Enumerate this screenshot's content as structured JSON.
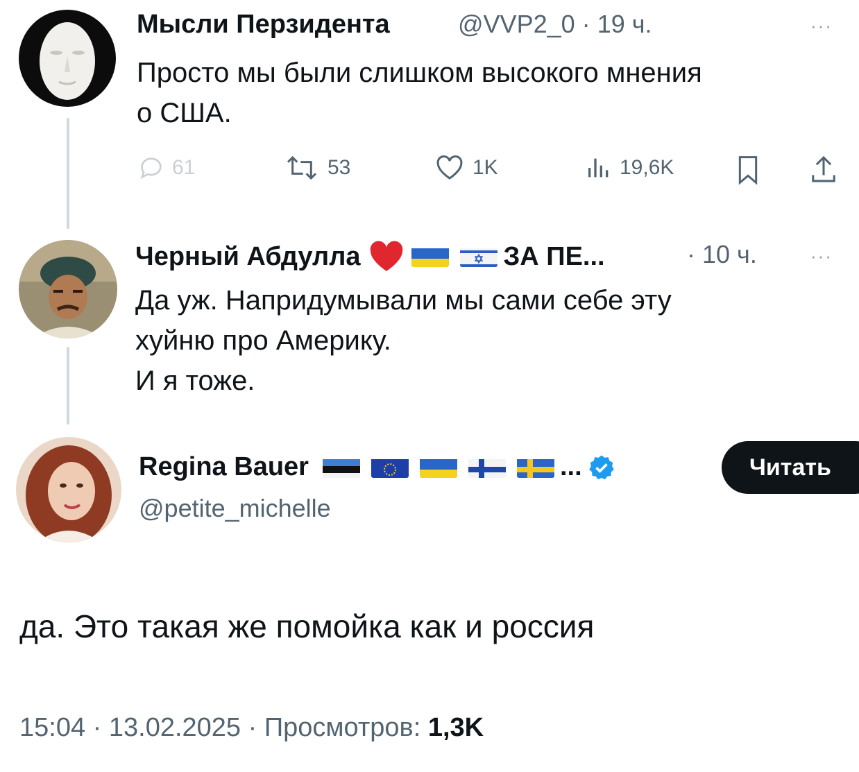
{
  "tweet1": {
    "name": "Мысли Перзидента",
    "handle": "@VVP2_0",
    "sep": "·",
    "time": "19 ч.",
    "more": "···",
    "lines": [
      "Просто мы были слишком высокого мнения",
      "о США."
    ],
    "actions": {
      "replies": "61",
      "retweets": "53",
      "likes": "1K",
      "views": "19,6K"
    }
  },
  "tweet2": {
    "name": "Черный Абдулла",
    "name_suffix": "ЗА ПЕ...",
    "sep": "·",
    "time": "10 ч.",
    "more": "···",
    "lines": [
      "Да уж. Напридумывали мы сами себе  эту",
      "хуйню про Америку.",
      "И я тоже."
    ]
  },
  "tweet3": {
    "name": "Regina Bauer",
    "name_ellipsis": "...",
    "handle": "@petite_michelle",
    "follow_label": "Читать",
    "text": "да. Это такая же помойка как и россия",
    "footer": {
      "time": "15:04",
      "sep1": "·",
      "date": "13.02.2025",
      "sep2": "·",
      "views_label": "Просмотров:",
      "views": "1,3K"
    }
  },
  "icons": {
    "reply": "reply-bubble-icon",
    "retweet": "retweet-icon",
    "like": "heart-icon",
    "views": "bar-chart-icon",
    "bookmark": "bookmark-icon",
    "share": "share-icon",
    "verified": "verified-badge-icon"
  },
  "colors": {
    "text": "#0f1419",
    "secondary": "#536471",
    "thread_line": "#cfd9de",
    "verified": "#1d9bf0",
    "button": "#0f1419"
  }
}
